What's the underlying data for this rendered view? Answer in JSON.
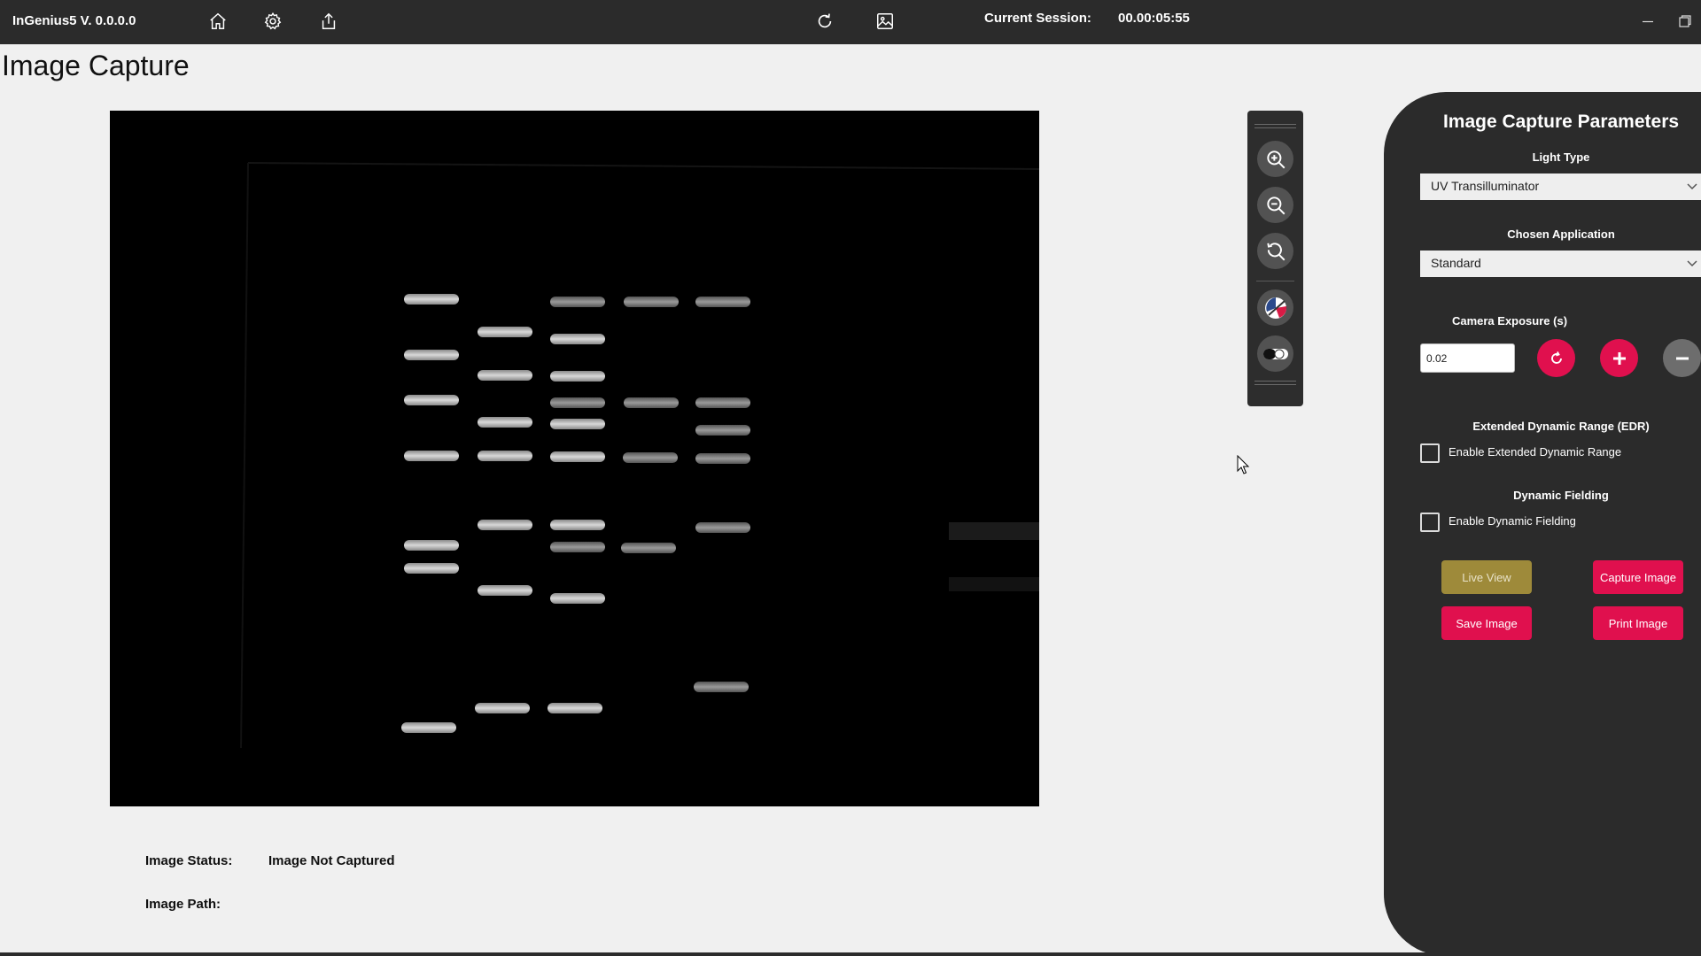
{
  "app": {
    "title": "InGenius5 V. 0.0.0.0",
    "session_label": "Current Session:",
    "session_value": "00.00:05:55"
  },
  "topbar_icons": [
    "home-icon",
    "settings-gear-icon",
    "share-upload-icon",
    "refresh-icon",
    "image-gallery-icon",
    "minimize-icon",
    "restore-window-icon"
  ],
  "page": {
    "title": "Image Capture"
  },
  "toolbar_icons": [
    "zoom-in-icon",
    "zoom-out-icon",
    "zoom-reset-icon",
    "color-invert-icon",
    "contrast-toggle-icon"
  ],
  "status": {
    "status_label": "Image Status:",
    "status_value": "Image Not Captured",
    "path_label": "Image Path:",
    "path_value": ""
  },
  "panel": {
    "title": "Image Capture Parameters",
    "light_type_label": "Light Type",
    "light_type_value": "UV Transilluminator",
    "application_label": "Chosen Application",
    "application_value": "Standard",
    "exposure_label": "Camera Exposure (s)",
    "exposure_value": "0.02",
    "edr_label": "Extended Dynamic Range (EDR)",
    "edr_checkbox_label": "Enable Extended Dynamic Range",
    "edr_checked": false,
    "df_label": "Dynamic Fielding",
    "df_checkbox_label": "Enable Dynamic Fielding",
    "df_checked": false,
    "buttons": {
      "live_view": "Live View",
      "capture": "Capture Image",
      "save": "Save Image",
      "print": "Print Image"
    }
  },
  "colors": {
    "topbar_bg": "#2b2b2b",
    "panel_bg": "#2b2b2b",
    "accent_red": "#e0104e",
    "live_view_gold": "#9e8a3a",
    "page_bg": "#f0f0f0"
  }
}
